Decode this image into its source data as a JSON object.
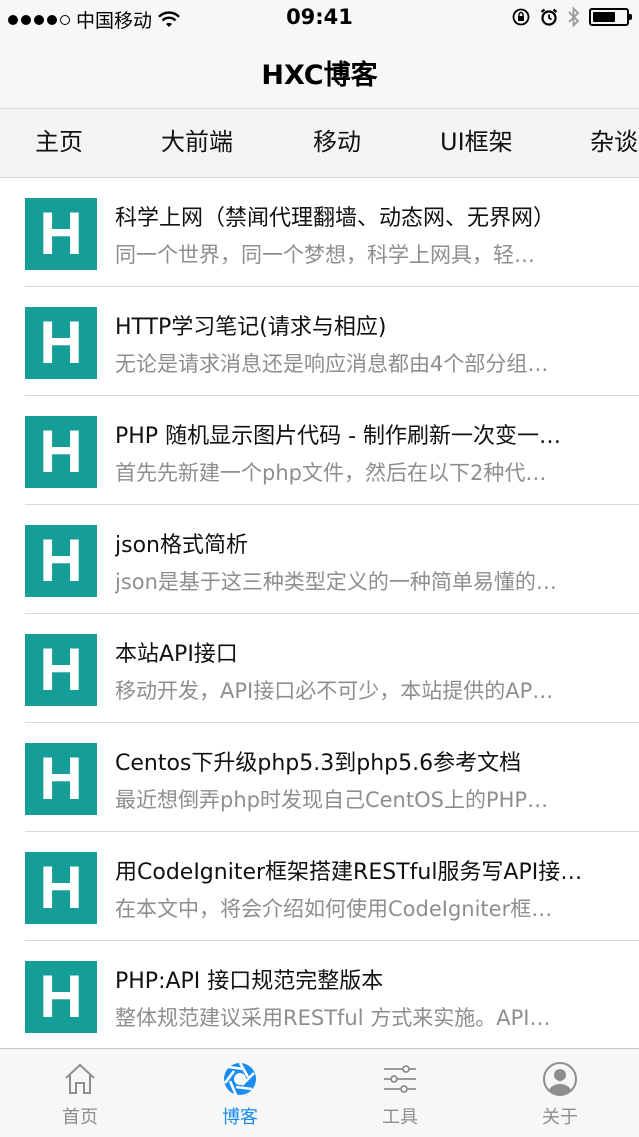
{
  "status": {
    "carrier": "中国移动",
    "time": "09:41"
  },
  "nav": {
    "title": "HXC博客"
  },
  "categories": [
    "主页",
    "大前端",
    "移动",
    "UI框架",
    "杂谈"
  ],
  "articles": [
    {
      "title": "科学上网（禁闻代理翻墙、动态网、无界网）",
      "summary": "同一个世界，同一个梦想，科学上网具，轻…"
    },
    {
      "title": "HTTP学习笔记(请求与相应)",
      "summary": "无论是请求消息还是响应消息都由4个部分组…"
    },
    {
      "title": "PHP 随机显示图片代码 - 制作刷新一次变一…",
      "summary": "首先先新建一个php文件，然后在以下2种代…"
    },
    {
      "title": "json格式简析",
      "summary": "json是基于这三种类型定义的一种简单易懂的…"
    },
    {
      "title": "本站API接口",
      "summary": "移动开发，API接口必不可少，本站提供的AP…"
    },
    {
      "title": "Centos下升级php5.3到php5.6参考文档",
      "summary": "最近想倒弄php时发现自己CentOS上的PHP…"
    },
    {
      "title": "用CodeIgniter框架搭建RESTful服务写API接…",
      "summary": "在本文中，将会介绍如何使用CodeIgniter框…"
    },
    {
      "title": "PHP:API 接口规范完整版本",
      "summary": "整体规范建议采用RESTful 方式来实施。API…"
    }
  ],
  "thumb_letter": "H",
  "thumb_color": "#159e98",
  "tabbar": {
    "items": [
      {
        "label": "首页",
        "icon": "home-icon",
        "active": false
      },
      {
        "label": "博客",
        "icon": "aperture-icon",
        "active": true
      },
      {
        "label": "工具",
        "icon": "sliders-icon",
        "active": false
      },
      {
        "label": "关于",
        "icon": "user-icon",
        "active": false
      }
    ],
    "active_color": "#1a8cf0"
  }
}
